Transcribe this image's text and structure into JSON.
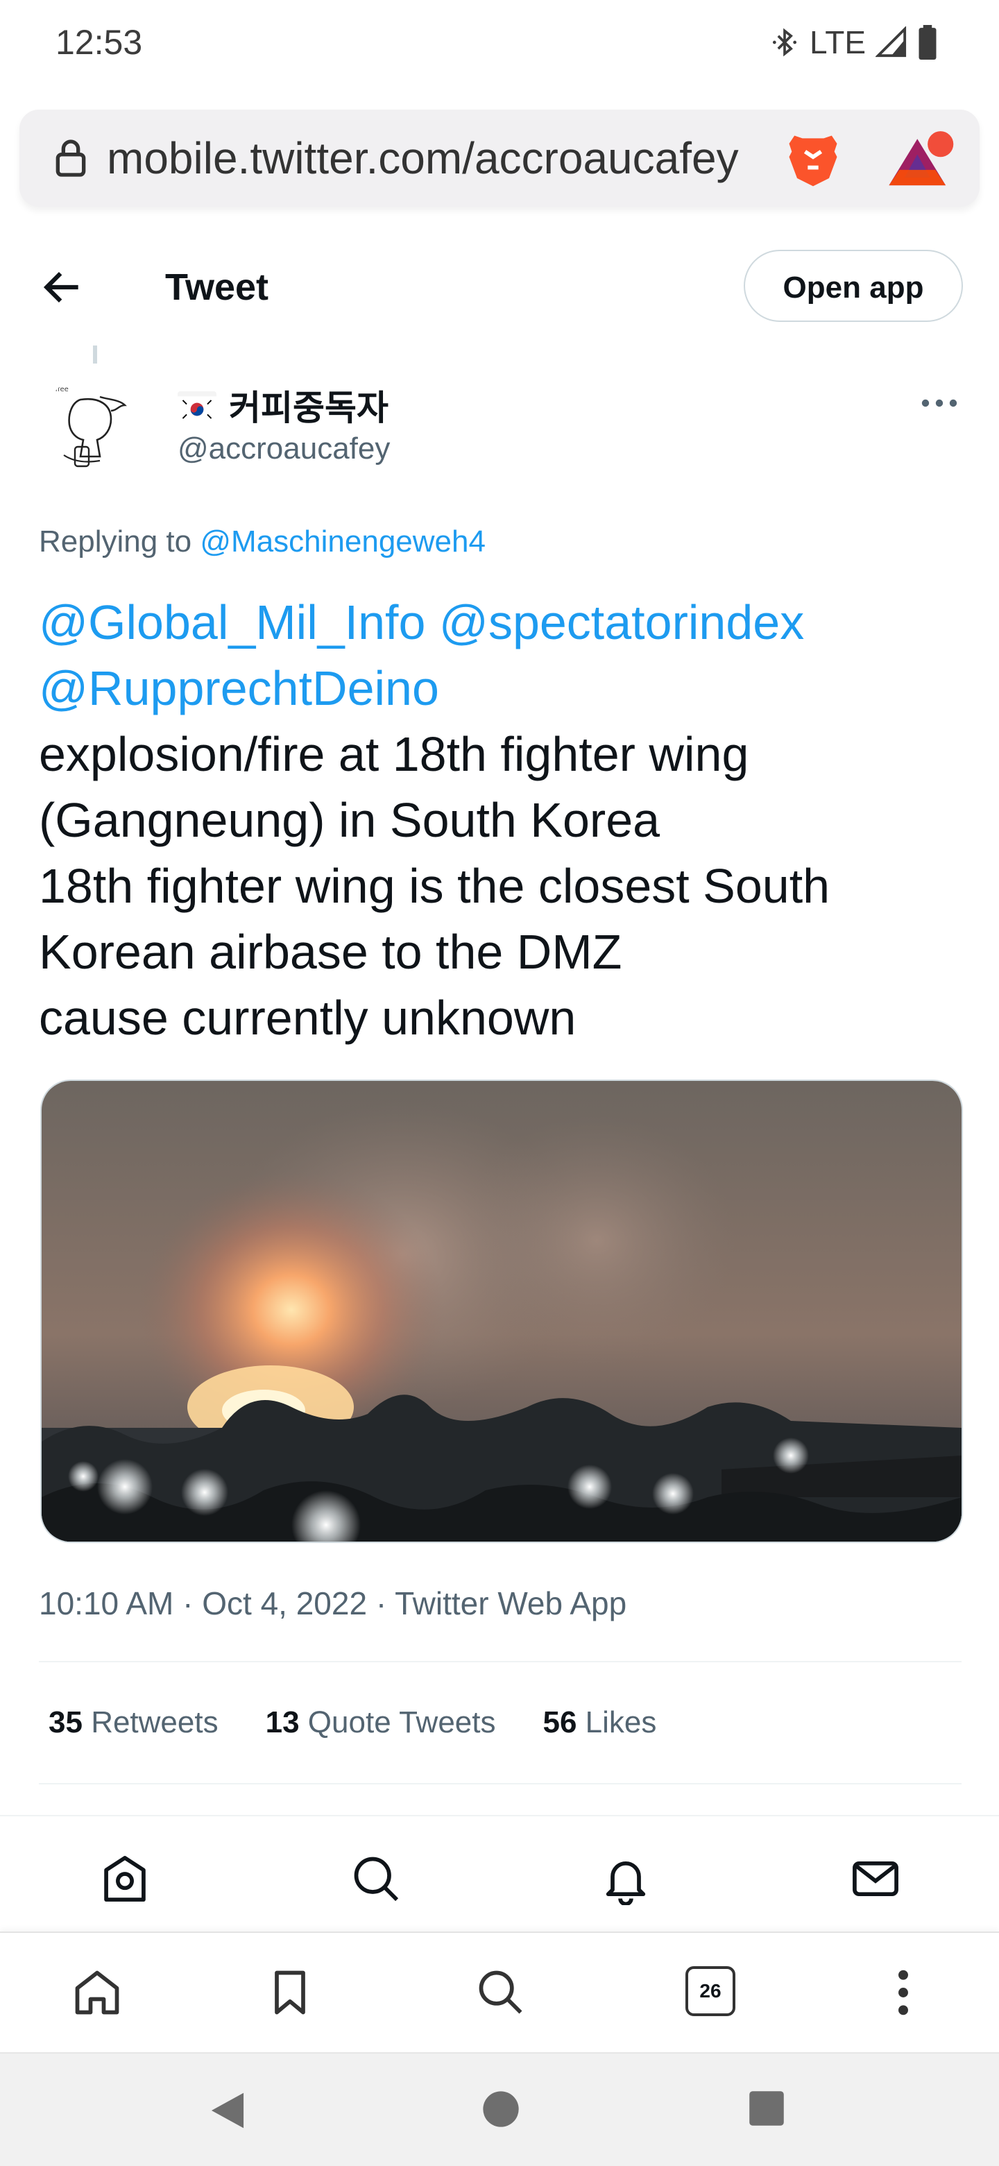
{
  "status_bar": {
    "time": "12:53",
    "network": "LTE",
    "icons": [
      "bluetooth-icon",
      "signal-icon",
      "battery-icon"
    ]
  },
  "browser": {
    "url": "mobile.twitter.com/accroaucafey",
    "icons": [
      "lock-icon",
      "brave-lion-icon",
      "bat-rewards-icon"
    ],
    "tab_count": "26"
  },
  "header": {
    "title": "Tweet",
    "open_app_label": "Open app"
  },
  "author": {
    "display_name": "커피중독자",
    "handle": "@accroaucafey",
    "flag": "south-korea-flag-icon"
  },
  "tweet": {
    "replying_prefix": "Replying to",
    "replying_to": "@Maschinengeweh4",
    "mentions_line1": "@Global_Mil_Info @spectatorindex",
    "mentions_line2": "@RupprechtDeino",
    "body_lines": [
      "explosion/fire at 18th fighter wing",
      "(Gangneung) in South Korea",
      "18th fighter wing is the closest South",
      "Korean airbase to the DMZ",
      "cause currently unknown"
    ],
    "meta": "10:10 AM · Oct 4, 2022 · Twitter Web App"
  },
  "stats": {
    "retweets_count": "35",
    "retweets_label": "Retweets",
    "quotes_count": "13",
    "quotes_label": "Quote Tweets",
    "likes_count": "56",
    "likes_label": "Likes"
  },
  "twitter_nav": [
    "home-icon",
    "explore-icon",
    "notifications-icon",
    "messages-icon"
  ],
  "browser_toolbar": [
    "home-icon",
    "bookmark-icon",
    "search-icon",
    "tabs-icon",
    "menu-icon"
  ],
  "android_nav": [
    "back-icon",
    "home-icon",
    "recents-icon"
  ],
  "colors": {
    "link": "#1d9bf0",
    "text": "#0f1419",
    "secondary": "#536471"
  }
}
